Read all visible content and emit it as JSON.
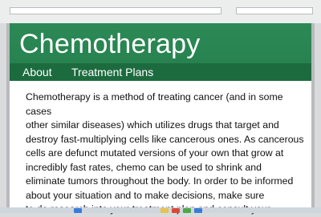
{
  "page": {
    "title": "Chemotherapy",
    "nav": [
      {
        "label": "About"
      },
      {
        "label": "Treatment Plans"
      }
    ],
    "body_lines": [
      "Chemotherapy is a method of treating cancer (and in some cases",
      "other similar diseases) which utilizes drugs that target and",
      "destroy fast-multiplying cells like cancerous ones.  As cancerous",
      "cells are defunct mutated versions of your own that grow at",
      "incredibly fast rates, chemo can be used to shrink and",
      "eliminate tumors throughout the body. In order to be informed",
      "about your situation  and to make decisions, make sure",
      "to do research into your treatment plan and consult your"
    ]
  },
  "colors": {
    "banner": "#2c8a56",
    "nav": "#1c6b3f",
    "text": "#111111"
  }
}
